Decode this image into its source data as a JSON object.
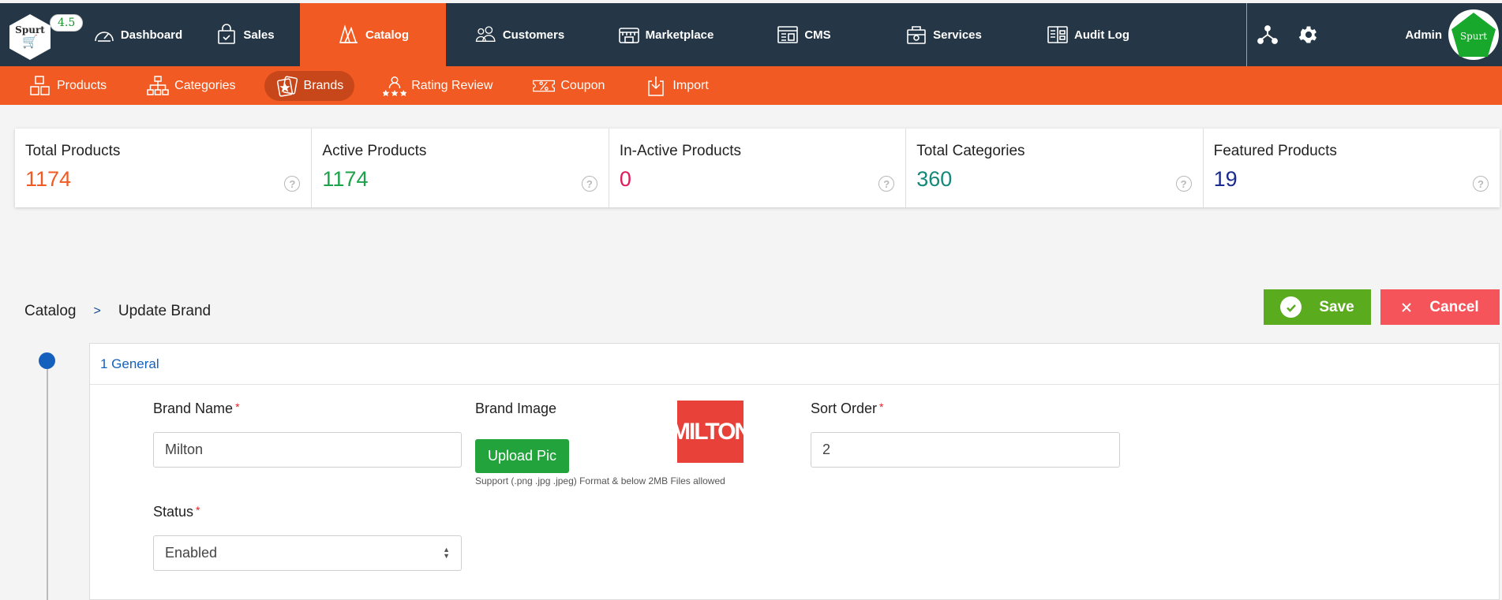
{
  "topnav": {
    "version": "4.5",
    "logo_text": "Spurt",
    "items": [
      {
        "label": "Dashboard",
        "icon": "speedometer-icon"
      },
      {
        "label": "Sales",
        "icon": "shopping-bag-icon"
      },
      {
        "label": "Catalog",
        "icon": "catalog-icon",
        "active": true
      },
      {
        "label": "Customers",
        "icon": "customers-icon"
      },
      {
        "label": "Marketplace",
        "icon": "marketplace-icon"
      },
      {
        "label": "CMS",
        "icon": "cms-icon"
      },
      {
        "label": "Services",
        "icon": "services-icon"
      },
      {
        "label": "Audit Log",
        "icon": "audit-log-icon"
      }
    ],
    "admin_label": "Admin",
    "avatar_text": "Spurt"
  },
  "subnav": {
    "items": [
      {
        "label": "Products",
        "icon": "products-icon"
      },
      {
        "label": "Categories",
        "icon": "categories-icon"
      },
      {
        "label": "Brands",
        "icon": "brands-icon",
        "active": true
      },
      {
        "label": "Rating Review",
        "icon": "rating-icon"
      },
      {
        "label": "Coupon",
        "icon": "coupon-icon"
      },
      {
        "label": "Import",
        "icon": "import-icon"
      }
    ]
  },
  "stats": [
    {
      "label": "Total Products",
      "value": "1174",
      "color": "#f15a22"
    },
    {
      "label": "Active Products",
      "value": "1174",
      "color": "#1aa34a"
    },
    {
      "label": "In-Active Products",
      "value": "0",
      "color": "#e0195a"
    },
    {
      "label": "Total Categories",
      "value": "360",
      "color": "#14897a"
    },
    {
      "label": "Featured Products",
      "value": "19",
      "color": "#1a2a8e"
    }
  ],
  "breadcrumb": {
    "root": "Catalog",
    "separator": ">",
    "current": "Update Brand"
  },
  "actions": {
    "save_label": "Save",
    "cancel_label": "Cancel"
  },
  "form": {
    "section_title": "1 General",
    "brand_name_label": "Brand Name",
    "brand_name_value": "Milton",
    "brand_image_label": "Brand Image",
    "upload_label": "Upload Pic",
    "upload_help": "Support (.png .jpg .jpeg) Format & below 2MB Files allowed",
    "brand_thumb_text": "MILTON",
    "sort_order_label": "Sort Order",
    "sort_order_value": "2",
    "status_label": "Status",
    "status_value": "Enabled"
  },
  "colors": {
    "nav_bg": "#253746",
    "accent": "#f15a22",
    "save": "#5aab1e",
    "cancel": "#f4545a",
    "upload": "#22a33b",
    "link": "#1560bd"
  }
}
